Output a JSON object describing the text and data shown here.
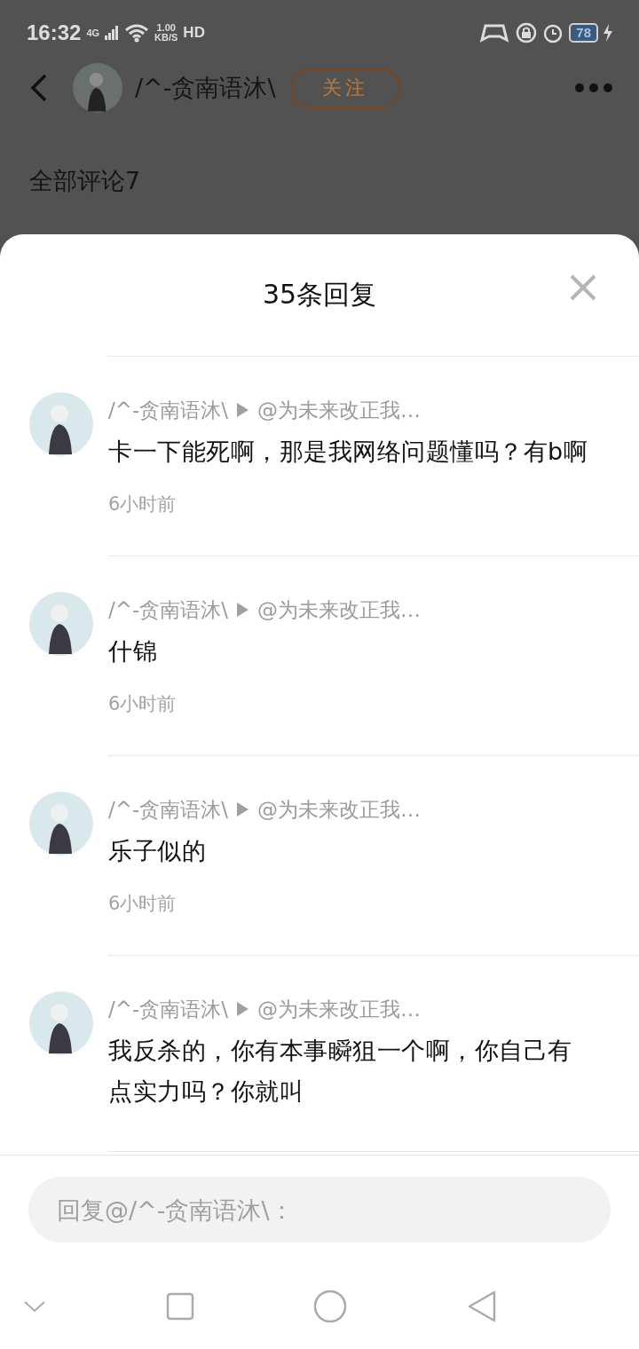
{
  "status_bar": {
    "time": "16:32",
    "network": "4G",
    "speed": "1.00",
    "speed_unit": "KB/S",
    "hd": "HD",
    "battery": "78"
  },
  "header": {
    "username": "/^-贪南语沐\\",
    "follow": "关注"
  },
  "comments_title": "全部评论7",
  "sheet": {
    "title": "35条回复",
    "replies": [
      {
        "name": "/^-贪南语沐\\",
        "reply_to": "@为未来改正我…",
        "text": "卡一下能死啊，那是我网络问题懂吗？有b啊",
        "time": "6小时前"
      },
      {
        "name": "/^-贪南语沐\\",
        "reply_to": "@为未来改正我…",
        "text": "什锦",
        "time": "6小时前"
      },
      {
        "name": "/^-贪南语沐\\",
        "reply_to": "@为未来改正我…",
        "text": "乐子似的",
        "time": "6小时前"
      },
      {
        "name": "/^-贪南语沐\\",
        "reply_to": "@为未来改正我…",
        "text": "我反杀的，你有本事瞬狙一个啊，你自己有点实力吗？你就叫"
      }
    ],
    "input": {
      "placeholder": "回复@/^-贪南语沐\\："
    }
  }
}
